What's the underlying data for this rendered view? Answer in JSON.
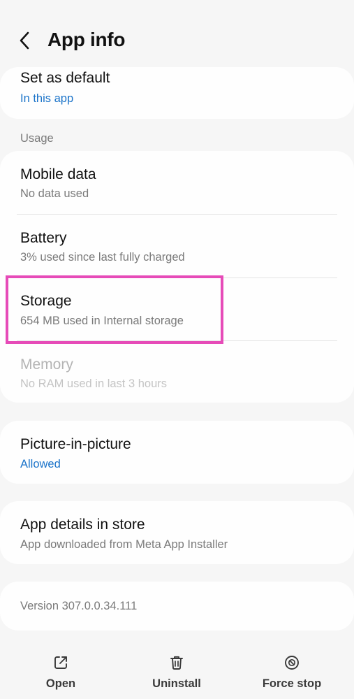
{
  "header": {
    "title": "App info",
    "back_icon": "chevron-left-icon"
  },
  "default_card": {
    "title": "Set as default",
    "subtitle": "In this app"
  },
  "usage": {
    "section_label": "Usage",
    "items": [
      {
        "title": "Mobile data",
        "subtitle": "No data used",
        "enabled": true
      },
      {
        "title": "Battery",
        "subtitle": "3% used since last fully charged",
        "enabled": true
      },
      {
        "title": "Storage",
        "subtitle": "654 MB used in Internal storage",
        "enabled": true
      },
      {
        "title": "Memory",
        "subtitle": "No RAM used in last 3 hours",
        "enabled": false
      }
    ]
  },
  "pip": {
    "title": "Picture-in-picture",
    "subtitle": "Allowed"
  },
  "store": {
    "title": "App details in store",
    "subtitle": "App downloaded from Meta App Installer"
  },
  "version": {
    "text": "Version 307.0.0.34.111"
  },
  "bottom_bar": {
    "open": {
      "label": "Open",
      "icon": "open-external-icon"
    },
    "uninstall": {
      "label": "Uninstall",
      "icon": "trash-icon"
    },
    "force_stop": {
      "label": "Force stop",
      "icon": "stop-circle-icon"
    }
  },
  "colors": {
    "background": "#f6f6f6",
    "card": "#fefefe",
    "accent": "#1a73c9",
    "highlight": "#e64bb8",
    "subtext": "#7a7a7a",
    "disabled": "#b4b4b4"
  }
}
